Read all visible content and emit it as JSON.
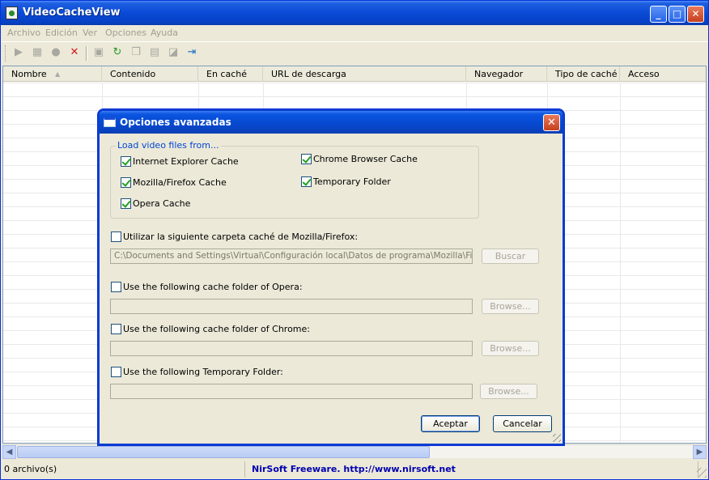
{
  "window": {
    "title": "VideoCacheView",
    "controls": {
      "minimize": "_",
      "maximize": "□",
      "close": "✕"
    }
  },
  "menu": [
    "Archivo",
    "Edición",
    "Ver",
    "Opciones",
    "Ayuda"
  ],
  "toolbar": {
    "icons": [
      "play-icon",
      "copy-file-icon",
      "record-icon",
      "delete-icon",
      "save-icon",
      "refresh-icon",
      "copy-icon",
      "properties-icon",
      "html-report-icon",
      "exit-icon"
    ]
  },
  "list": {
    "columns": [
      "Nombre",
      "Contenido",
      "En caché",
      "URL de descarga",
      "Navegador",
      "Tipo de caché",
      "Acceso"
    ],
    "sort_indicator": "▲"
  },
  "statusbar": {
    "count": "0 archivo(s)",
    "link": "NirSoft Freeware.  http://www.nirsoft.net"
  },
  "dialog": {
    "title": "Opciones avanzadas",
    "group_label": "Load video files from...",
    "sources": [
      {
        "label": "Internet Explorer Cache",
        "checked": true
      },
      {
        "label": "Mozilla/Firefox Cache",
        "checked": true
      },
      {
        "label": "Opera Cache",
        "checked": true
      },
      {
        "label": "Chrome Browser Cache",
        "checked": true
      },
      {
        "label": "Temporary Folder",
        "checked": true
      }
    ],
    "mozilla_folder": {
      "label": "Utilizar la siguiente carpeta caché de Mozilla/Firefox:",
      "checked": false,
      "path": "C:\\Documents and Settings\\Virtual\\Configuración local\\Datos de programa\\Mozilla\\Firefox\\P",
      "button": "Buscar"
    },
    "opera_folder": {
      "label": "Use the following cache folder of Opera:",
      "checked": false,
      "path": "",
      "button": "Browse..."
    },
    "chrome_folder": {
      "label": "Use the following cache folder of Chrome:",
      "checked": false,
      "path": "",
      "button": "Browse..."
    },
    "temp_folder": {
      "label": "Use the following Temporary Folder:",
      "checked": false,
      "path": "",
      "button": "Browse..."
    },
    "ok_button": "Aceptar",
    "cancel_button": "Cancelar"
  }
}
